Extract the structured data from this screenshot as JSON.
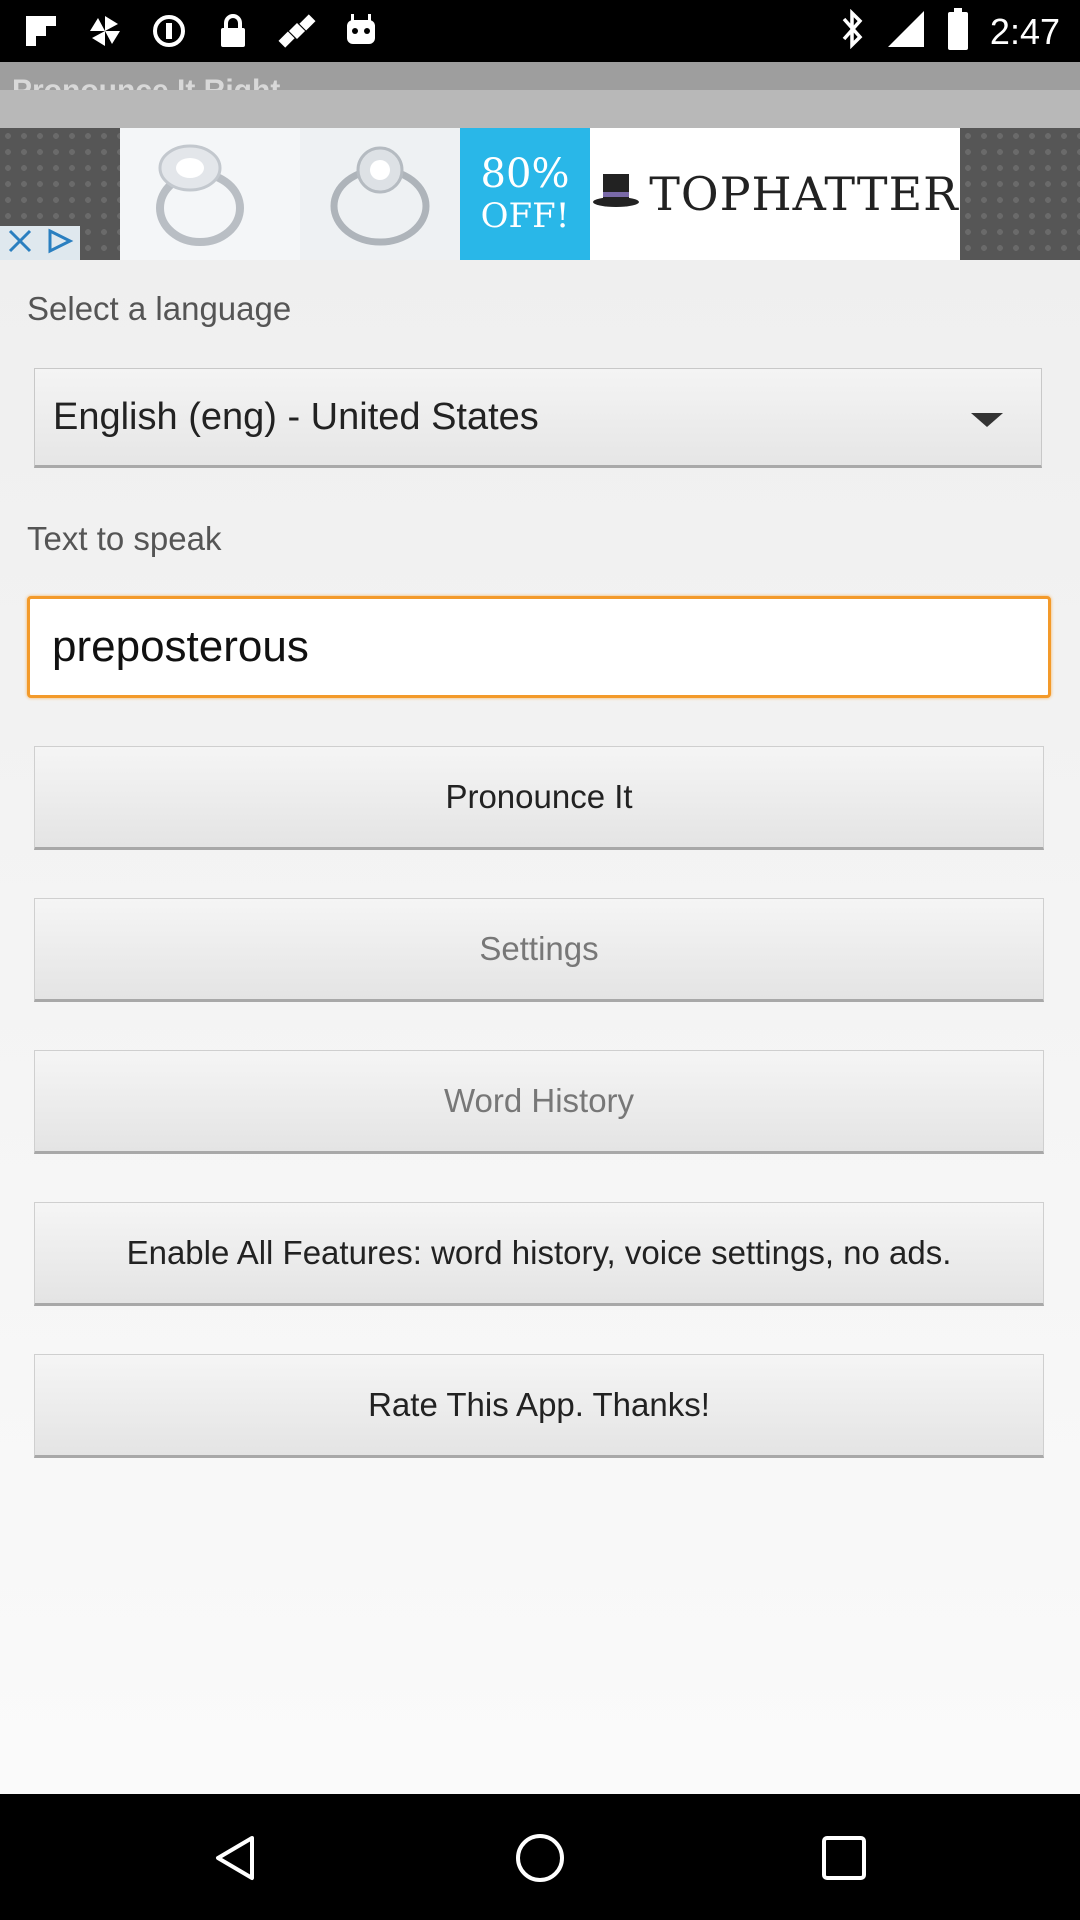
{
  "status_bar": {
    "time": "2:47",
    "left_icons": [
      "flipboard-icon",
      "pinwheel-icon",
      "circle-icon",
      "lock-icon",
      "satellite-icon",
      "android-icon"
    ],
    "right_icons": [
      "bluetooth-icon",
      "signal-icon",
      "battery-icon"
    ]
  },
  "app_bar": {
    "title": "Pronounce It Right"
  },
  "ad": {
    "discount_line1": "80%",
    "discount_line2": "OFF!",
    "brand": "TOPHATTER"
  },
  "form": {
    "language_label": "Select a language",
    "language_value": "English (eng) - United States",
    "text_label": "Text to speak",
    "text_value": "preposterous"
  },
  "buttons": {
    "pronounce": "Pronounce It",
    "settings": "Settings",
    "history": "Word History",
    "enable": "Enable All Features: word history, voice settings, no ads.",
    "rate": "Rate This App. Thanks!"
  },
  "colors": {
    "input_focus_border": "#f39a2a",
    "ad_blue": "#29b7e8"
  }
}
